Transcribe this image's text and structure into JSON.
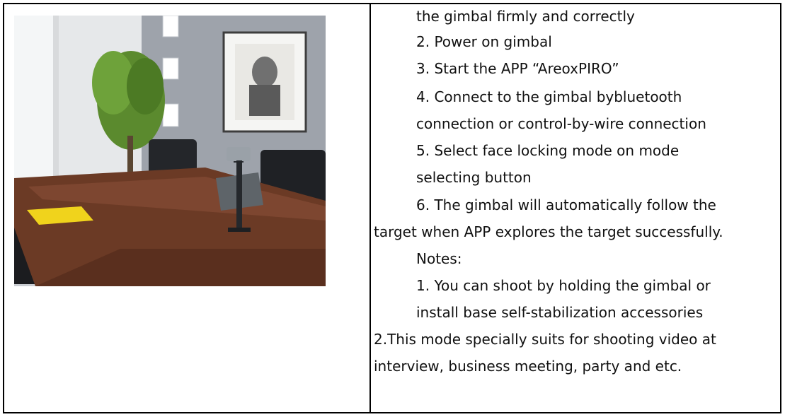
{
  "photo": {
    "alt": ""
  },
  "content": {
    "lines": [
      {
        "text": "the gimbal firmly and correctly",
        "indent": true
      },
      {
        "text": "2. Power on gimbal",
        "indent": true
      },
      {
        "text": "3. Start the APP “AreoxPIRO”",
        "indent": true
      },
      {
        "text": "4. Connect to the gimbal bybluetooth",
        "indent": true
      },
      {
        "text": "connection or control-by-wire connection",
        "indent": true
      },
      {
        "text": "5. Select face locking mode on mode",
        "indent": true
      },
      {
        "text": "selecting button",
        "indent": true
      },
      {
        "text": "6. The gimbal will automatically follow the",
        "indent": true
      },
      {
        "text": "target when APP explores the target successfully.",
        "indent": false
      },
      {
        "text": "Notes:",
        "indent": true
      },
      {
        "text": "1. You can shoot by holding the gimbal or",
        "indent": true
      },
      {
        "text": "install base self-stabilization accessories",
        "indent": true
      },
      {
        "text": "2.This mode specially suits for shooting video at",
        "indent": false
      },
      {
        "text": "interview, business meeting, party and etc.",
        "indent": false
      }
    ]
  }
}
